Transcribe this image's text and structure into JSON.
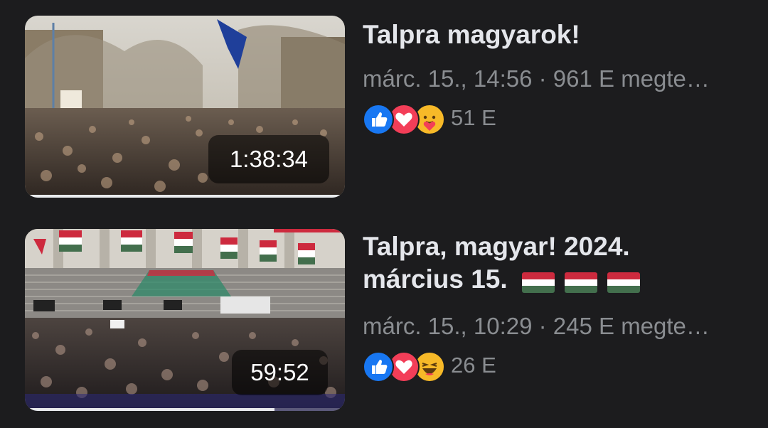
{
  "videos": [
    {
      "title_line1": "Talpra magyarok!",
      "title_line2": "",
      "duration": "1:38:34",
      "meta": "márc. 15., 14:56 · 961 E megte…",
      "reaction_icons": [
        "like-icon",
        "love-icon",
        "care-icon"
      ],
      "reaction_count": "51 E",
      "progress": 1.0,
      "has_flags": false
    },
    {
      "title_line1": "Talpra, magyar! 2024.",
      "title_line2": "március 15.",
      "duration": "59:52",
      "meta": "márc. 15., 10:29 · 245 E megte…",
      "reaction_icons": [
        "like-icon",
        "love-icon",
        "haha-icon"
      ],
      "reaction_count": "26 E",
      "progress": 0.78,
      "has_flags": true,
      "flag_count": 3
    }
  ],
  "colors": {
    "background": "#1c1c1e",
    "title": "#e4e6eb",
    "meta": "#8a8d91",
    "like": "#1877f2",
    "love": "#f33e58",
    "emoji": "#f7b928",
    "flag_red": "#cd2a3e",
    "flag_white": "#ffffff",
    "flag_green": "#436f4d"
  }
}
